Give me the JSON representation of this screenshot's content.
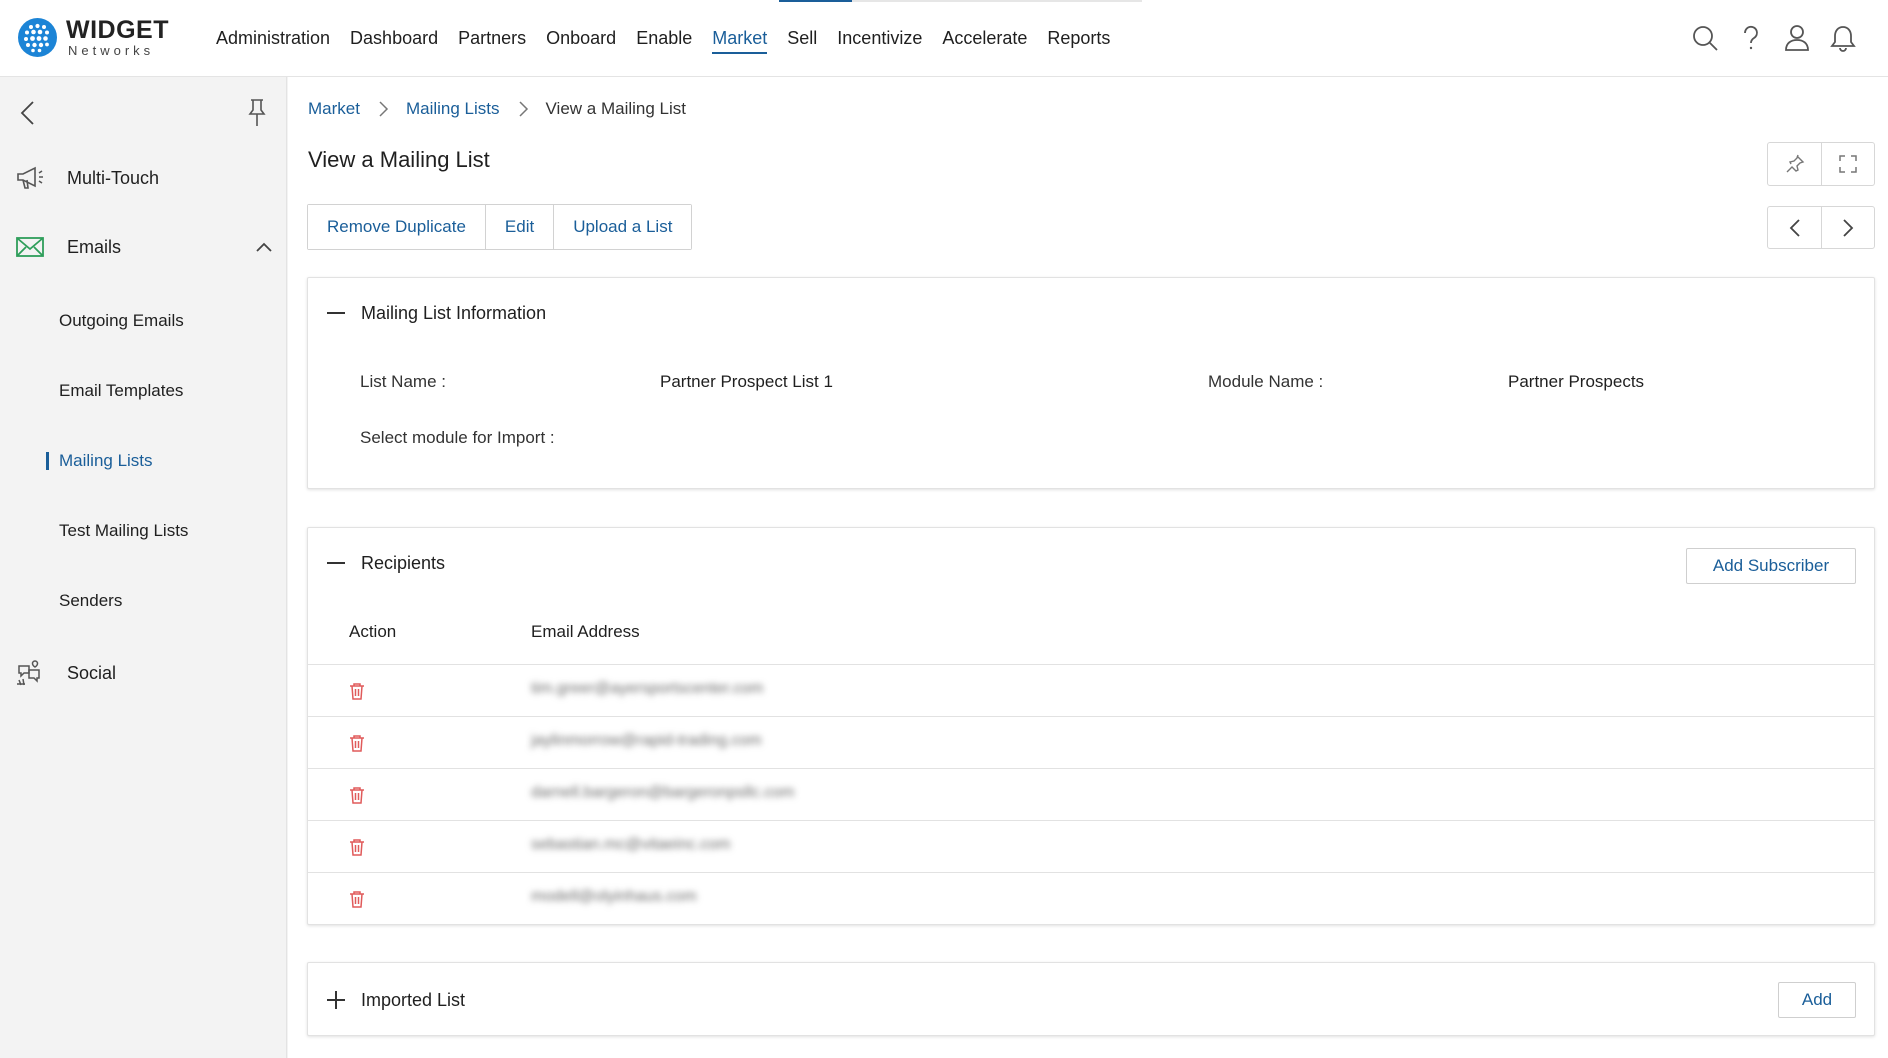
{
  "brand": {
    "name": "WIDGET",
    "sub": "Networks"
  },
  "nav": {
    "items": [
      "Administration",
      "Dashboard",
      "Partners",
      "Onboard",
      "Enable",
      "Market",
      "Sell",
      "Incentivize",
      "Accelerate",
      "Reports"
    ],
    "active": "Market"
  },
  "top_icons": [
    "search-icon",
    "help-icon",
    "user-icon",
    "bell-icon"
  ],
  "sidebar": {
    "groups": [
      {
        "label": "Multi-Touch",
        "icon": "megaphone-icon"
      },
      {
        "label": "Emails",
        "icon": "envelope-icon",
        "expanded": true
      },
      {
        "label": "Social",
        "icon": "social-icon"
      }
    ],
    "email_items": [
      "Outgoing Emails",
      "Email Templates",
      "Mailing Lists",
      "Test Mailing Lists",
      "Senders"
    ],
    "active_item": "Mailing Lists"
  },
  "breadcrumb": {
    "items": [
      "Market",
      "Mailing Lists"
    ],
    "current": "View a Mailing List"
  },
  "page": {
    "title": "View a Mailing List"
  },
  "actions": {
    "remove_duplicate": "Remove Duplicate",
    "edit": "Edit",
    "upload": "Upload a List"
  },
  "info": {
    "title": "Mailing List Information",
    "list_name_label": "List Name :",
    "list_name_value": "Partner Prospect List 1",
    "module_name_label": "Module Name :",
    "module_name_value": "Partner Prospects",
    "import_label": "Select module for Import :"
  },
  "recipients": {
    "title": "Recipients",
    "add_button": "Add Subscriber",
    "columns": [
      "Action",
      "Email Address"
    ],
    "rows": [
      "tim.greer@ayersportscenter.com",
      "jaylinmorrow@rapid-trading.com",
      "darnell.bargeron@bargeronpsllc.com",
      "sebastian.mc@vitaeinc.com",
      "modell@olyinhaus.com"
    ]
  },
  "imported": {
    "title": "Imported List",
    "add_button": "Add"
  },
  "colors": {
    "accent": "#1a5e99",
    "danger": "#e05a5a",
    "logo": "#1c84d6"
  }
}
